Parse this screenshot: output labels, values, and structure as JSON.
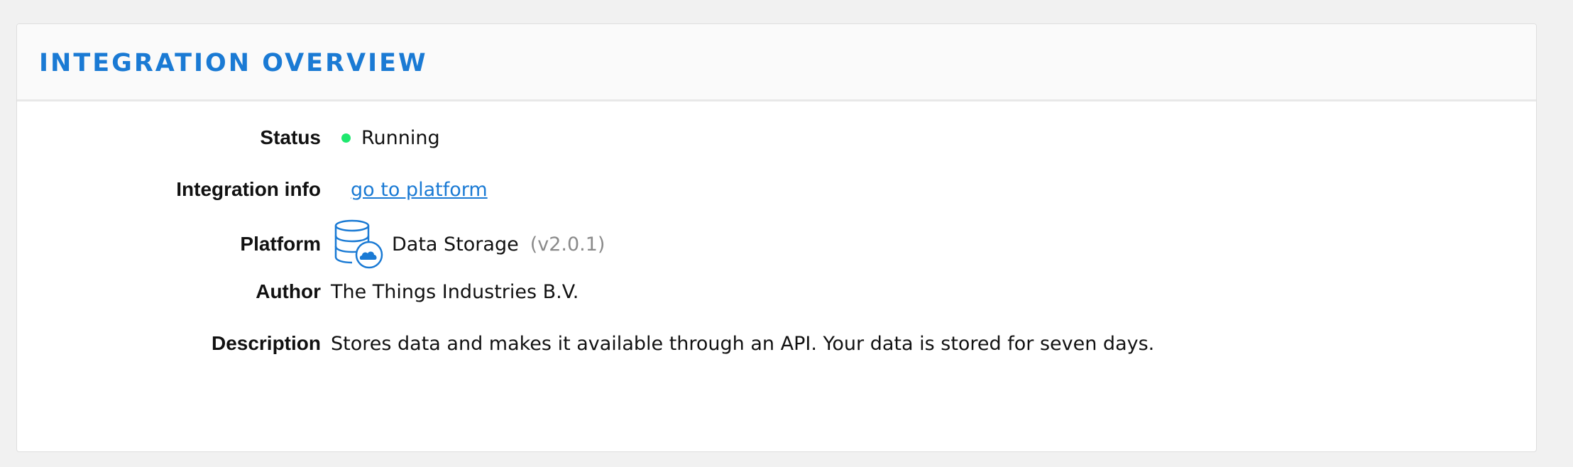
{
  "header": {
    "title": "INTEGRATION OVERVIEW"
  },
  "status": {
    "label": "Status",
    "value": "Running",
    "dot_color": "#1ee86e"
  },
  "integration_info": {
    "label": "Integration info",
    "link_text": "go to platform"
  },
  "platform": {
    "label": "Platform",
    "icon": "database-cloud-icon",
    "name": "Data Storage",
    "version": "(v2.0.1)"
  },
  "author": {
    "label": "Author",
    "value": "The Things Industries B.V."
  },
  "description": {
    "label": "Description",
    "value": "Stores data and makes it available through an API. Your data is stored for seven days."
  },
  "colors": {
    "accent": "#1a7ad4",
    "background": "#f1f1f1",
    "panel": "#ffffff"
  }
}
